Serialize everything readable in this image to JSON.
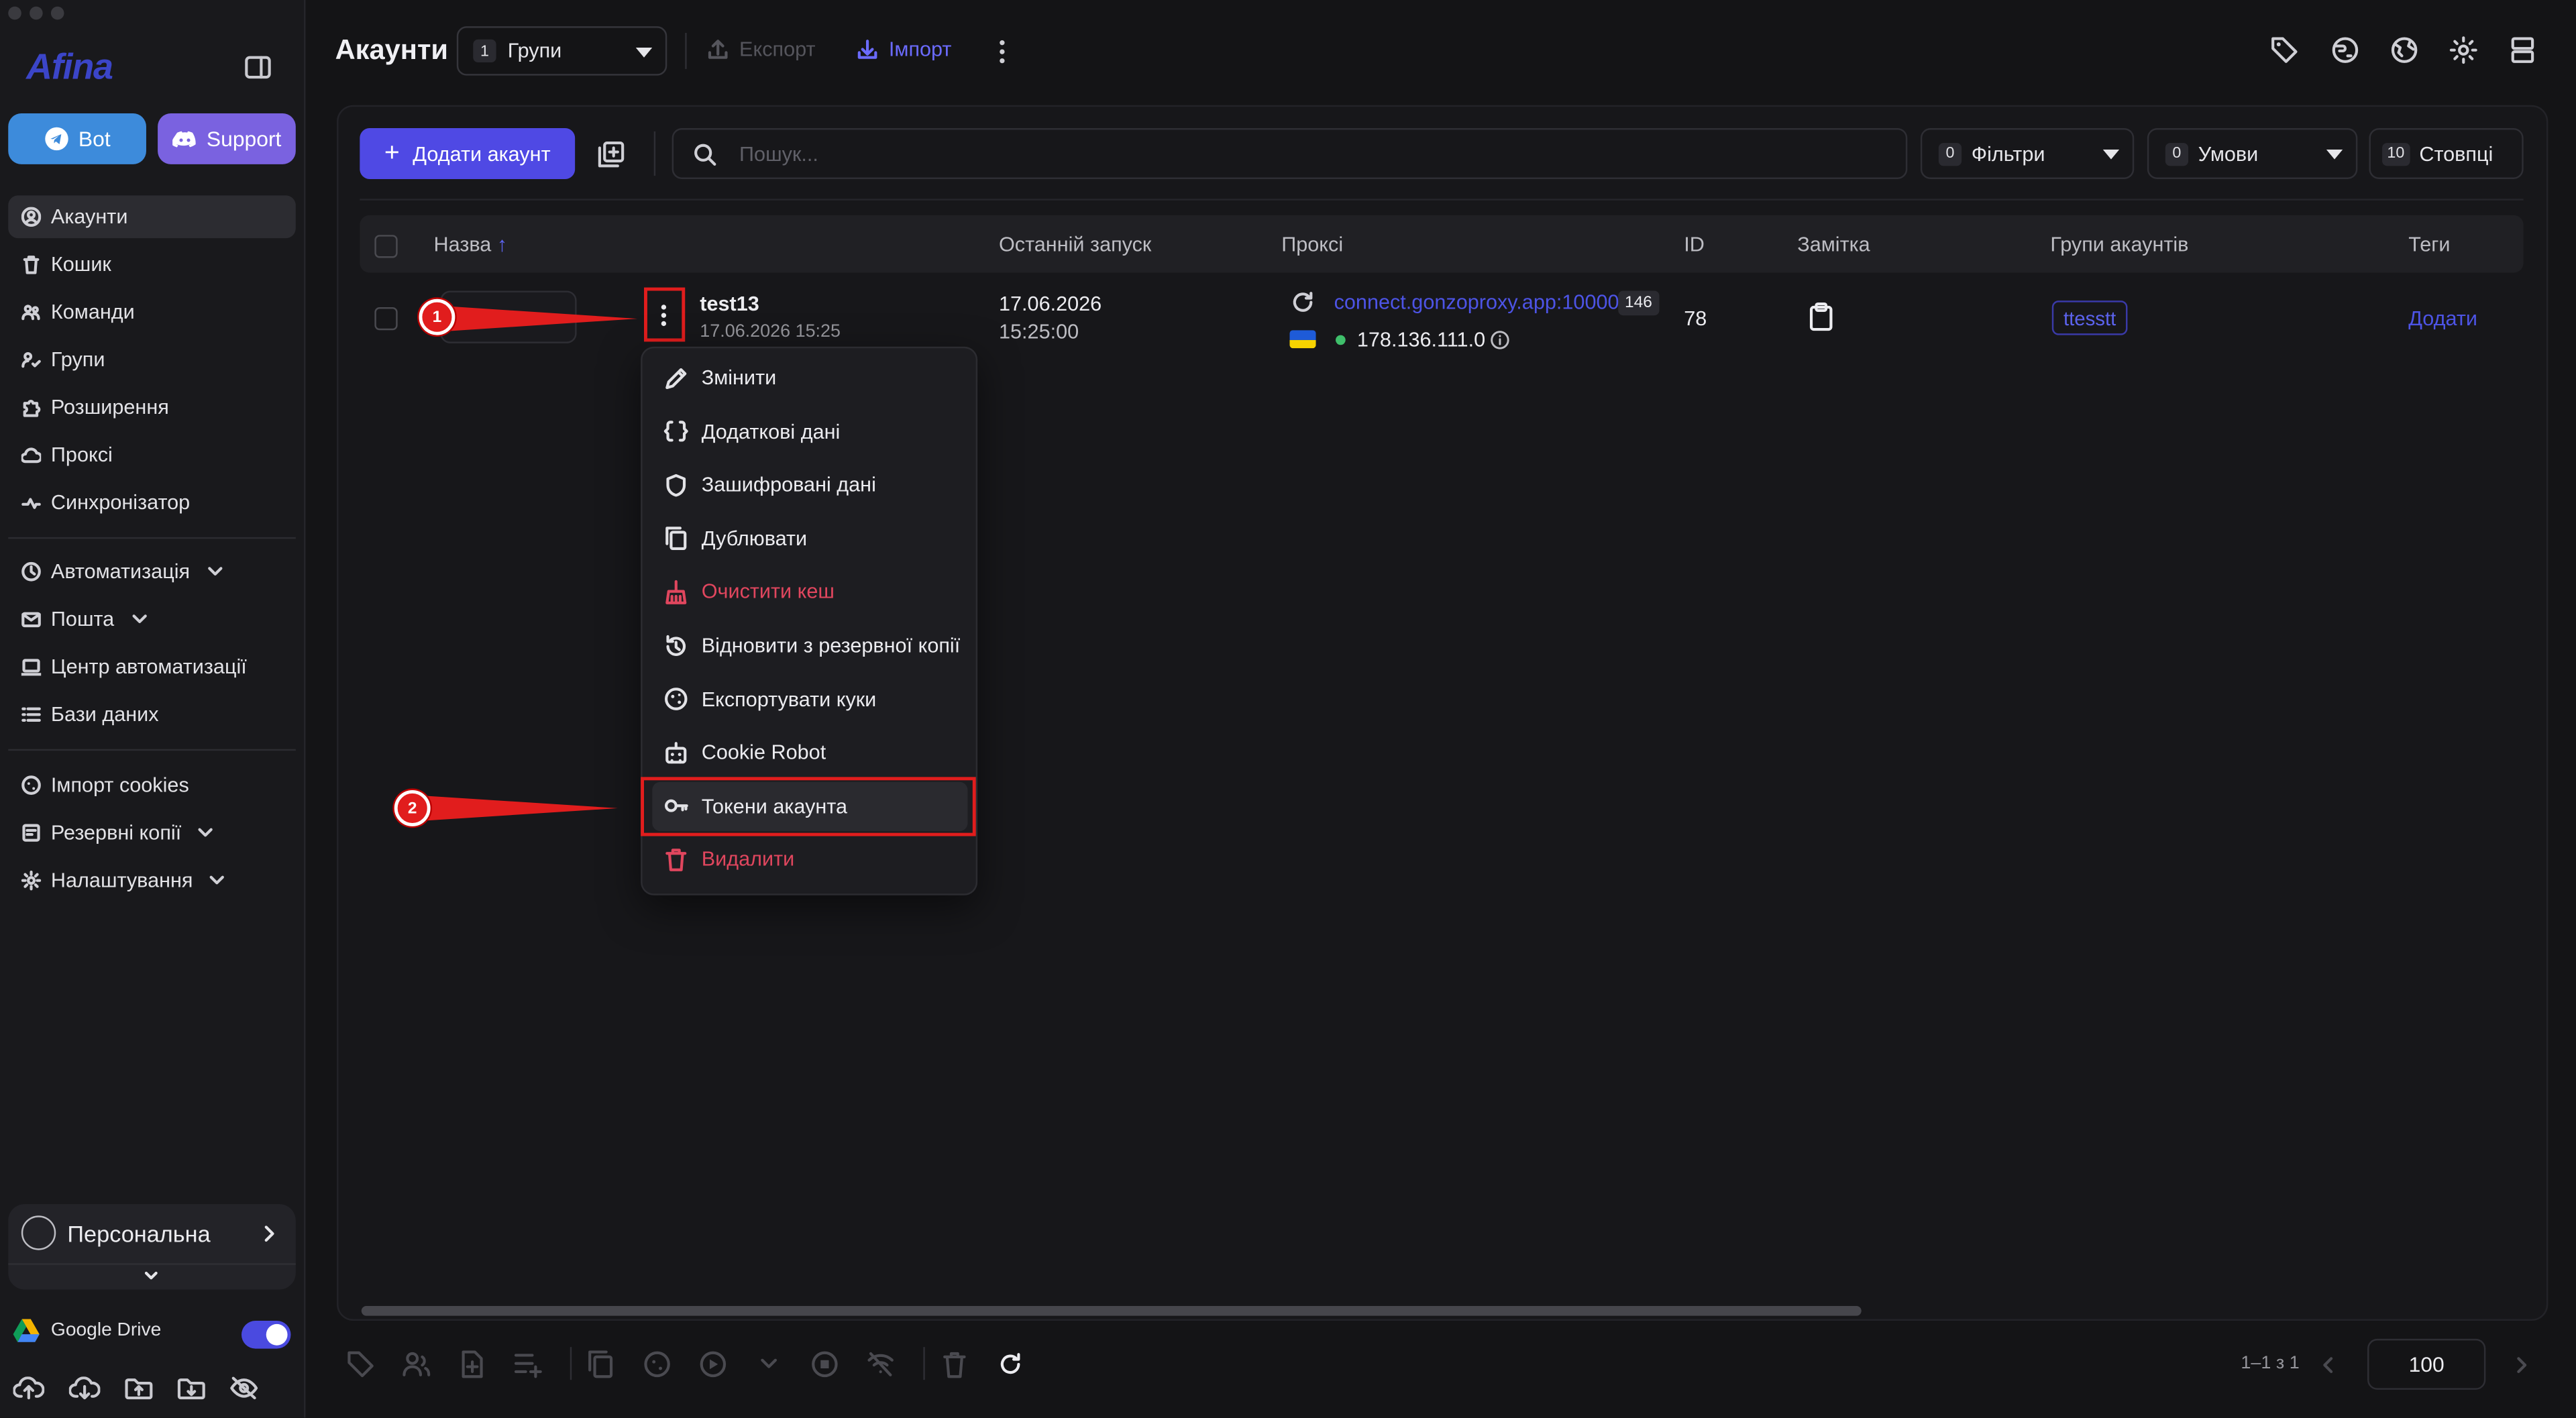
{
  "window": {
    "app": "Afina"
  },
  "sidebar": {
    "logo": "Afina",
    "bot_label": "Bot",
    "support_label": "Support",
    "group1": [
      "Акаунти",
      "Кошик",
      "Команди",
      "Групи",
      "Розширення",
      "Проксі",
      "Синхронізатор"
    ],
    "group2": [
      "Автоматизація",
      "Пошта",
      "Центр автоматизації",
      "Бази даних"
    ],
    "group3": [
      "Імпорт cookies",
      "Резервні копії",
      "Налаштування"
    ],
    "profile": "Персональна",
    "google_drive": "Google Drive",
    "google_drive_enabled": true
  },
  "header": {
    "title": "Акаунти",
    "groups_count": "1",
    "groups_label": "Групи",
    "export_label": "Експорт",
    "import_label": "Імпорт"
  },
  "toolbar": {
    "add_account": "Додати акаунт",
    "search_placeholder": "Пошук...",
    "filters_count": "0",
    "filters_label": "Фільтри",
    "conditions_count": "0",
    "conditions_label": "Умови",
    "columns_count": "10",
    "columns_label": "Стовпці"
  },
  "table": {
    "columns": [
      "Назва",
      "Останній запуск",
      "Проксі",
      "ID",
      "Замітка",
      "Групи акаунтів",
      "Теги"
    ],
    "row": {
      "name": "test13",
      "created": "17.06.2026 15:25",
      "last_run_date": "17.06.2026",
      "last_run_time": "15:25:00",
      "proxy_host": "connect.gonzoproxy.app:10000",
      "proxy_count": "146",
      "proxy_ip": "178.136.111.0",
      "id": "78",
      "group_tag": "ttesstt",
      "tags_add": "Додати"
    }
  },
  "context_menu": {
    "items": [
      "Змінити",
      "Додаткові дані",
      "Зашифровані дані",
      "Дублювати",
      "Очистити кеш",
      "Відновити з резервної копії",
      "Експортувати куки",
      "Cookie Robot",
      "Токени акаунта",
      "Видалити"
    ],
    "highlighted": "Токени акаунта"
  },
  "annotations": {
    "marker1": "1",
    "marker2": "2"
  },
  "pagination": {
    "range": "1–1 з 1",
    "page_size": "100"
  },
  "colors": {
    "accent": "#4f49e4",
    "danger": "#e0465e",
    "annotation": "#e11d1d"
  }
}
